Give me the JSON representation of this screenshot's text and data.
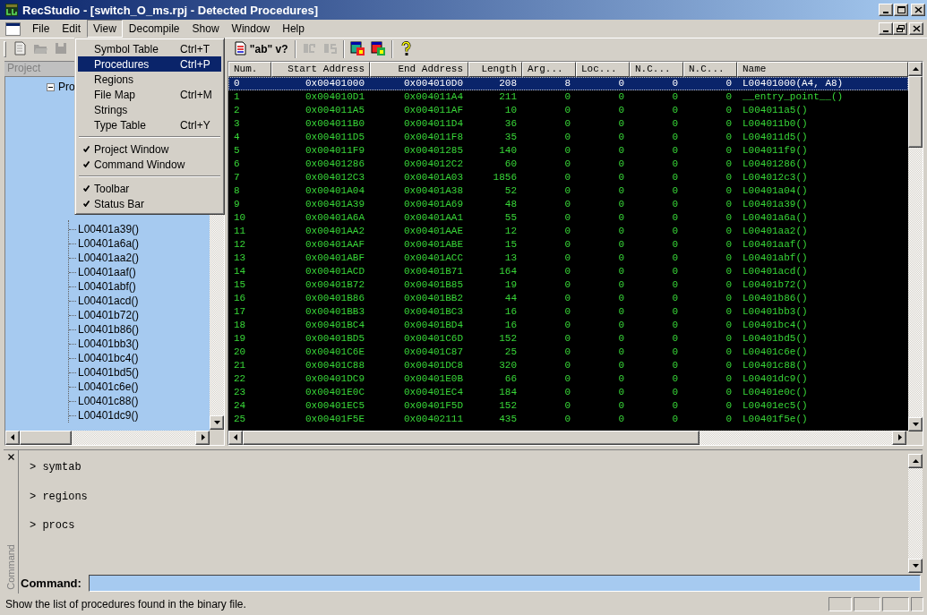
{
  "window": {
    "title": "RecStudio - [switch_O_ms.rpj - Detected Procedures]"
  },
  "menubar": [
    {
      "label": "File",
      "selected": false
    },
    {
      "label": "Edit",
      "selected": false
    },
    {
      "label": "View",
      "selected": true
    },
    {
      "label": "Decompile",
      "selected": false
    },
    {
      "label": "Show",
      "selected": false
    },
    {
      "label": "Window",
      "selected": false
    },
    {
      "label": "Help",
      "selected": false
    }
  ],
  "view_menu": [
    {
      "kind": "item",
      "label": "Symbol Table",
      "shortcut": "Ctrl+T",
      "checked": false,
      "selected": false
    },
    {
      "kind": "item",
      "label": "Procedures",
      "shortcut": "Ctrl+P",
      "checked": false,
      "selected": true
    },
    {
      "kind": "item",
      "label": "Regions",
      "checked": false,
      "selected": false
    },
    {
      "kind": "item",
      "label": "File Map",
      "shortcut": "Ctrl+M",
      "checked": false,
      "selected": false
    },
    {
      "kind": "item",
      "label": "Strings",
      "checked": false,
      "selected": false
    },
    {
      "kind": "item",
      "label": "Type Table",
      "shortcut": "Ctrl+Y",
      "checked": false,
      "selected": false
    },
    {
      "kind": "separator"
    },
    {
      "kind": "item",
      "label": "Project Window",
      "checked": true,
      "selected": false
    },
    {
      "kind": "item",
      "label": "Command Window",
      "checked": true,
      "selected": false
    },
    {
      "kind": "separator"
    },
    {
      "kind": "item",
      "label": "Toolbar",
      "checked": true,
      "selected": false
    },
    {
      "kind": "item",
      "label": "Status Bar",
      "checked": true,
      "selected": false
    }
  ],
  "toolbar": {
    "left": [
      {
        "kind": "icon",
        "disabled": true
      },
      {
        "kind": "icon",
        "disabled": true
      },
      {
        "kind": "icon",
        "disabled": true
      }
    ],
    "right": [
      {
        "kind": "icon",
        "disabled": false
      },
      {
        "kind": "text",
        "label": "\"ab\""
      },
      {
        "kind": "text",
        "label": "v?"
      },
      {
        "kind": "separator"
      },
      {
        "kind": "icon",
        "disabled": true
      },
      {
        "kind": "icon",
        "disabled": true
      },
      {
        "kind": "separator"
      },
      {
        "kind": "icon",
        "disabled": false
      },
      {
        "kind": "icon",
        "disabled": false
      },
      {
        "kind": "separator"
      },
      {
        "kind": "icon",
        "disabled": false
      }
    ]
  },
  "project": {
    "title": "Project",
    "tree": {
      "label": "Pro",
      "expanded": true,
      "children": [
        {
          "label": "L00401a39()"
        },
        {
          "label": "L00401a6a()"
        },
        {
          "label": "L00401aa2()"
        },
        {
          "label": "L00401aaf()"
        },
        {
          "label": "L00401abf()"
        },
        {
          "label": "L00401acd()"
        },
        {
          "label": "L00401b72()"
        },
        {
          "label": "L00401b86()"
        },
        {
          "label": "L00401bb3()"
        },
        {
          "label": "L00401bc4()"
        },
        {
          "label": "L00401bd5()"
        },
        {
          "label": "L00401c6e()"
        },
        {
          "label": "L00401c88()"
        },
        {
          "label": "L00401dc9()"
        }
      ]
    }
  },
  "table": {
    "columns": [
      "Num.",
      "Start Address",
      "End Address",
      "Length",
      "Arg...",
      "Loc...",
      "N.C...",
      "N.C...",
      "Name"
    ],
    "rows": [
      {
        "selected": true,
        "cells": [
          "0",
          "0x00401000",
          "0x004010D0",
          "208",
          "8",
          "0",
          "0",
          "0",
          "L00401000(A4, A8)"
        ]
      },
      {
        "selected": false,
        "cells": [
          "1",
          "0x004010D1",
          "0x004011A4",
          "211",
          "0",
          "0",
          "0",
          "0",
          "__entry_point__()"
        ]
      },
      {
        "selected": false,
        "cells": [
          "2",
          "0x004011A5",
          "0x004011AF",
          "10",
          "0",
          "0",
          "0",
          "0",
          "L004011a5()"
        ]
      },
      {
        "selected": false,
        "cells": [
          "3",
          "0x004011B0",
          "0x004011D4",
          "36",
          "0",
          "0",
          "0",
          "0",
          "L004011b0()"
        ]
      },
      {
        "selected": false,
        "cells": [
          "4",
          "0x004011D5",
          "0x004011F8",
          "35",
          "0",
          "0",
          "0",
          "0",
          "L004011d5()"
        ]
      },
      {
        "selected": false,
        "cells": [
          "5",
          "0x004011F9",
          "0x00401285",
          "140",
          "0",
          "0",
          "0",
          "0",
          "L004011f9()"
        ]
      },
      {
        "selected": false,
        "cells": [
          "6",
          "0x00401286",
          "0x004012C2",
          "60",
          "0",
          "0",
          "0",
          "0",
          "L00401286()"
        ]
      },
      {
        "selected": false,
        "cells": [
          "7",
          "0x004012C3",
          "0x00401A03",
          "1856",
          "0",
          "0",
          "0",
          "0",
          "L004012c3()"
        ]
      },
      {
        "selected": false,
        "cells": [
          "8",
          "0x00401A04",
          "0x00401A38",
          "52",
          "0",
          "0",
          "0",
          "0",
          "L00401a04()"
        ]
      },
      {
        "selected": false,
        "cells": [
          "9",
          "0x00401A39",
          "0x00401A69",
          "48",
          "0",
          "0",
          "0",
          "0",
          "L00401a39()"
        ]
      },
      {
        "selected": false,
        "cells": [
          "10",
          "0x00401A6A",
          "0x00401AA1",
          "55",
          "0",
          "0",
          "0",
          "0",
          "L00401a6a()"
        ]
      },
      {
        "selected": false,
        "cells": [
          "11",
          "0x00401AA2",
          "0x00401AAE",
          "12",
          "0",
          "0",
          "0",
          "0",
          "L00401aa2()"
        ]
      },
      {
        "selected": false,
        "cells": [
          "12",
          "0x00401AAF",
          "0x00401ABE",
          "15",
          "0",
          "0",
          "0",
          "0",
          "L00401aaf()"
        ]
      },
      {
        "selected": false,
        "cells": [
          "13",
          "0x00401ABF",
          "0x00401ACC",
          "13",
          "0",
          "0",
          "0",
          "0",
          "L00401abf()"
        ]
      },
      {
        "selected": false,
        "cells": [
          "14",
          "0x00401ACD",
          "0x00401B71",
          "164",
          "0",
          "0",
          "0",
          "0",
          "L00401acd()"
        ]
      },
      {
        "selected": false,
        "cells": [
          "15",
          "0x00401B72",
          "0x00401B85",
          "19",
          "0",
          "0",
          "0",
          "0",
          "L00401b72()"
        ]
      },
      {
        "selected": false,
        "cells": [
          "16",
          "0x00401B86",
          "0x00401BB2",
          "44",
          "0",
          "0",
          "0",
          "0",
          "L00401b86()"
        ]
      },
      {
        "selected": false,
        "cells": [
          "17",
          "0x00401BB3",
          "0x00401BC3",
          "16",
          "0",
          "0",
          "0",
          "0",
          "L00401bb3()"
        ]
      },
      {
        "selected": false,
        "cells": [
          "18",
          "0x00401BC4",
          "0x00401BD4",
          "16",
          "0",
          "0",
          "0",
          "0",
          "L00401bc4()"
        ]
      },
      {
        "selected": false,
        "cells": [
          "19",
          "0x00401BD5",
          "0x00401C6D",
          "152",
          "0",
          "0",
          "0",
          "0",
          "L00401bd5()"
        ]
      },
      {
        "selected": false,
        "cells": [
          "20",
          "0x00401C6E",
          "0x00401C87",
          "25",
          "0",
          "0",
          "0",
          "0",
          "L00401c6e()"
        ]
      },
      {
        "selected": false,
        "cells": [
          "21",
          "0x00401C88",
          "0x00401DC8",
          "320",
          "0",
          "0",
          "0",
          "0",
          "L00401c88()"
        ]
      },
      {
        "selected": false,
        "cells": [
          "22",
          "0x00401DC9",
          "0x00401E0B",
          "66",
          "0",
          "0",
          "0",
          "0",
          "L00401dc9()"
        ]
      },
      {
        "selected": false,
        "cells": [
          "23",
          "0x00401E0C",
          "0x00401EC4",
          "184",
          "0",
          "0",
          "0",
          "0",
          "L00401e0c()"
        ]
      },
      {
        "selected": false,
        "cells": [
          "24",
          "0x00401EC5",
          "0x00401F5D",
          "152",
          "0",
          "0",
          "0",
          "0",
          "L00401ec5()"
        ]
      },
      {
        "selected": false,
        "cells": [
          "25",
          "0x00401F5E",
          "0x00402111",
          "435",
          "0",
          "0",
          "0",
          "0",
          "L00401f5e()"
        ]
      }
    ]
  },
  "console": {
    "side_label": "Command",
    "lines": [
      "> symtab",
      "> regions",
      "> procs"
    ],
    "command_label": "Command:"
  },
  "status_bar": {
    "text": "Show the list of procedures found in the binary file."
  }
}
